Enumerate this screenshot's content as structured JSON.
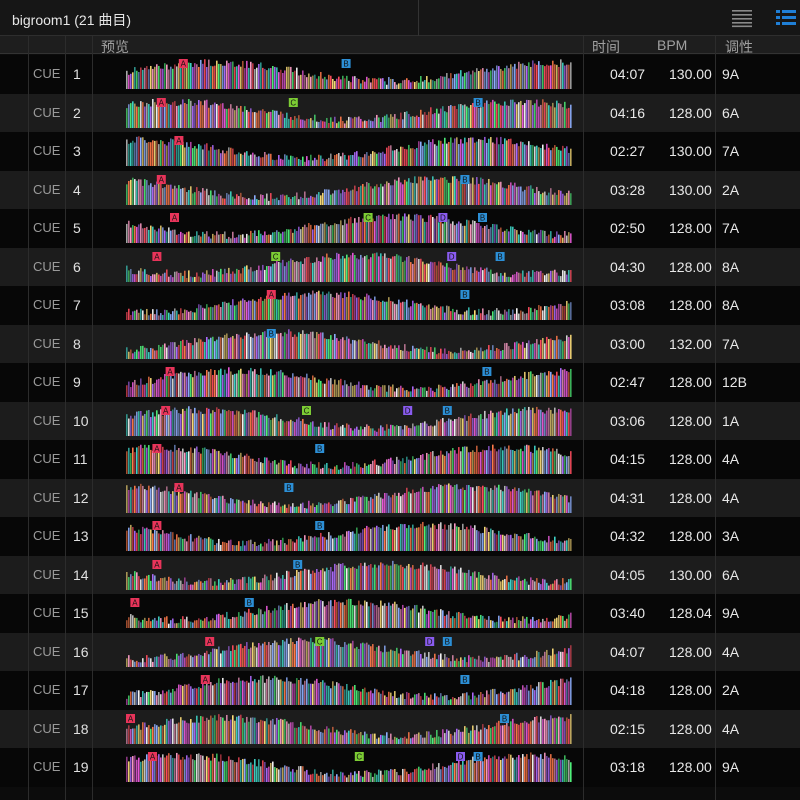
{
  "window": {
    "title": "bigroom1 (21 曲目)"
  },
  "toolbar": {
    "list_view_icon": "list-lines-icon",
    "detail_view_icon": "detail-list-icon",
    "accent": "#1f7fd6"
  },
  "columns": {
    "preview": "预览",
    "time": "时间",
    "bpm": "BPM",
    "key": "调性"
  },
  "cue_label": "CUE",
  "hot_cue_colors": {
    "A": "#e8345a",
    "B": "#2c8fd6",
    "C": "#7ccc34",
    "D": "#8a5cf0"
  },
  "tracks": [
    {
      "num": "1",
      "time": "04:07",
      "bpm": "130.00",
      "key": "9A",
      "cues": [
        {
          "l": "A",
          "p": 0.12
        },
        {
          "l": "B",
          "p": 0.49
        }
      ]
    },
    {
      "num": "2",
      "time": "04:16",
      "bpm": "128.00",
      "key": "6A",
      "cues": [
        {
          "l": "A",
          "p": 0.07
        },
        {
          "l": "C",
          "p": 0.37
        },
        {
          "l": "B",
          "p": 0.79
        }
      ]
    },
    {
      "num": "3",
      "time": "02:27",
      "bpm": "130.00",
      "key": "7A",
      "cues": [
        {
          "l": "A",
          "p": 0.11
        }
      ]
    },
    {
      "num": "4",
      "time": "03:28",
      "bpm": "130.00",
      "key": "2A",
      "cues": [
        {
          "l": "A",
          "p": 0.07
        },
        {
          "l": "B",
          "p": 0.76
        }
      ]
    },
    {
      "num": "5",
      "time": "02:50",
      "bpm": "128.00",
      "key": "7A",
      "cues": [
        {
          "l": "A",
          "p": 0.1
        },
        {
          "l": "C",
          "p": 0.54
        },
        {
          "l": "D",
          "p": 0.71
        },
        {
          "l": "B",
          "p": 0.8
        }
      ]
    },
    {
      "num": "6",
      "time": "04:30",
      "bpm": "128.00",
      "key": "8A",
      "cues": [
        {
          "l": "A",
          "p": 0.06
        },
        {
          "l": "C",
          "p": 0.33
        },
        {
          "l": "D",
          "p": 0.73
        },
        {
          "l": "B",
          "p": 0.84
        }
      ]
    },
    {
      "num": "7",
      "time": "03:08",
      "bpm": "128.00",
      "key": "8A",
      "cues": [
        {
          "l": "A",
          "p": 0.32
        },
        {
          "l": "B",
          "p": 0.76
        }
      ]
    },
    {
      "num": "8",
      "time": "03:00",
      "bpm": "132.00",
      "key": "7A",
      "cues": [
        {
          "l": "B",
          "p": 0.32
        }
      ]
    },
    {
      "num": "9",
      "time": "02:47",
      "bpm": "128.00",
      "key": "12B",
      "cues": [
        {
          "l": "A",
          "p": 0.09
        },
        {
          "l": "B",
          "p": 0.81
        }
      ]
    },
    {
      "num": "10",
      "time": "03:06",
      "bpm": "128.00",
      "key": "1A",
      "cues": [
        {
          "l": "A",
          "p": 0.08
        },
        {
          "l": "C",
          "p": 0.4
        },
        {
          "l": "D",
          "p": 0.63
        },
        {
          "l": "B",
          "p": 0.72
        }
      ]
    },
    {
      "num": "11",
      "time": "04:15",
      "bpm": "128.00",
      "key": "4A",
      "cues": [
        {
          "l": "A",
          "p": 0.06
        },
        {
          "l": "B",
          "p": 0.43
        }
      ]
    },
    {
      "num": "12",
      "time": "04:31",
      "bpm": "128.00",
      "key": "4A",
      "cues": [
        {
          "l": "A",
          "p": 0.11
        },
        {
          "l": "B",
          "p": 0.36
        }
      ]
    },
    {
      "num": "13",
      "time": "04:32",
      "bpm": "128.00",
      "key": "3A",
      "cues": [
        {
          "l": "A",
          "p": 0.06
        },
        {
          "l": "B",
          "p": 0.43
        }
      ]
    },
    {
      "num": "14",
      "time": "04:05",
      "bpm": "130.00",
      "key": "6A",
      "cues": [
        {
          "l": "A",
          "p": 0.06
        },
        {
          "l": "B",
          "p": 0.38
        }
      ]
    },
    {
      "num": "15",
      "time": "03:40",
      "bpm": "128.04",
      "key": "9A",
      "cues": [
        {
          "l": "A",
          "p": 0.01
        },
        {
          "l": "B",
          "p": 0.27
        }
      ]
    },
    {
      "num": "16",
      "time": "04:07",
      "bpm": "128.00",
      "key": "4A",
      "cues": [
        {
          "l": "A",
          "p": 0.18
        },
        {
          "l": "C",
          "p": 0.43
        },
        {
          "l": "D",
          "p": 0.68
        },
        {
          "l": "B",
          "p": 0.72
        }
      ]
    },
    {
      "num": "17",
      "time": "04:18",
      "bpm": "128.00",
      "key": "2A",
      "cues": [
        {
          "l": "A",
          "p": 0.17
        },
        {
          "l": "B",
          "p": 0.76
        }
      ]
    },
    {
      "num": "18",
      "time": "02:15",
      "bpm": "128.00",
      "key": "4A",
      "cues": [
        {
          "l": "A",
          "p": 0.0
        },
        {
          "l": "B",
          "p": 0.85
        }
      ]
    },
    {
      "num": "19",
      "time": "03:18",
      "bpm": "128.00",
      "key": "9A",
      "cues": [
        {
          "l": "A",
          "p": 0.05
        },
        {
          "l": "C",
          "p": 0.52
        },
        {
          "l": "D",
          "p": 0.75
        },
        {
          "l": "B",
          "p": 0.79
        }
      ]
    }
  ]
}
